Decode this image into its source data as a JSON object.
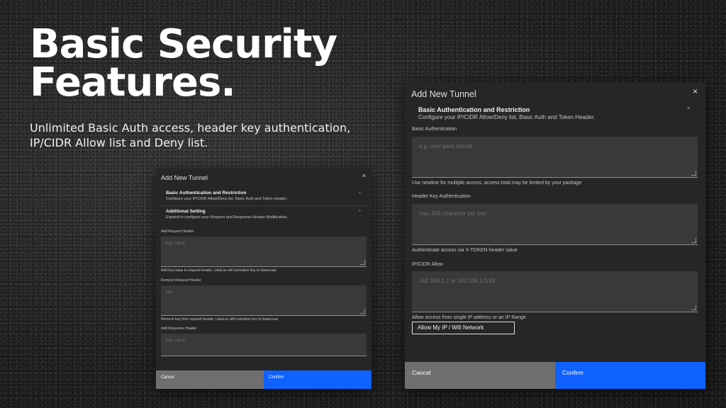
{
  "hero": {
    "title_line1": "Basic Security",
    "title_line2": "Features.",
    "subtitle": "Unlimited Basic Auth access, header key authentication, IP/CIDR Allow list and Deny list."
  },
  "small_modal": {
    "title": "Add New Tunnel",
    "close_icon": "×",
    "section1": {
      "heading": "Basic Authentication and Restriction",
      "description": "Configure your IP/CIDR Allow/Deny list, Basic Auth and Token Header.",
      "chevron": "⌄"
    },
    "section2": {
      "heading": "Additional Setting",
      "description": "Expand to configure your Request and Response Header Modification.",
      "chevron": "⌃"
    },
    "add_request_header": {
      "label": "Add Request Header",
      "placeholder": "key: value",
      "helper": "Add key:value to request header, Lokal.so will normalize key to lowercase"
    },
    "remove_request_header": {
      "label": "Remove Request Header",
      "placeholder": "key",
      "helper": "Remove key from request header, Lokal.so will normalize key to lowercase"
    },
    "add_response_header": {
      "label": "Add Response Header",
      "placeholder": "key: value"
    },
    "cancel_label": "Cancel",
    "confirm_label": "Confirm"
  },
  "large_modal": {
    "title": "Add New Tunnel",
    "close_icon": "×",
    "section1": {
      "heading": "Basic Authentication and Restriction",
      "description": "Configure your IP/CIDR Allow/Deny list, Basic Auth and Token Header.",
      "chevron": "⌃"
    },
    "basic_auth": {
      "label": "Basic Authentication",
      "placeholder": "e.g. user:pass format",
      "helper": "Use newline for multiple access, access total may be limited by your package"
    },
    "header_key": {
      "label": "Header Key Authentication",
      "placeholder": "max 256 character per line",
      "helper": "Authenticate access via X-TOKEN header value"
    },
    "ip_allow": {
      "label": "IP/CIDR Allow",
      "placeholder": "192.168.1.1 or 192.168.1.0/29",
      "helper": "Allow access from single IP address or an IP Range"
    },
    "allow_my_ip_label": "Allow My IP / Wifi Network",
    "cancel_label": "Cancel",
    "confirm_label": "Confirm"
  }
}
